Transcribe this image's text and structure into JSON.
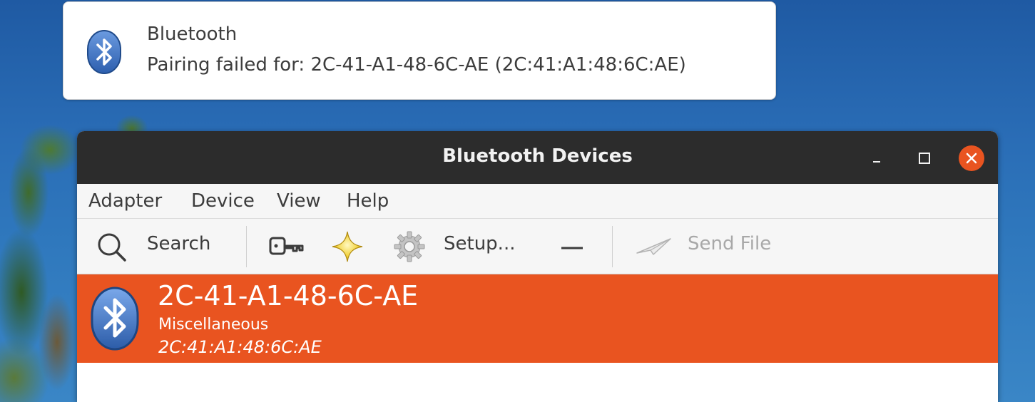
{
  "notification": {
    "title": "Bluetooth",
    "body": "Pairing failed for: 2C-41-A1-48-6C-AE (2C:41:A1:48:6C:AE)",
    "icon": "bluetooth-icon"
  },
  "window": {
    "title": "Bluetooth Devices",
    "controls": [
      "minimize",
      "maximize",
      "close"
    ],
    "close_color": "#e95420"
  },
  "menubar": {
    "items": [
      {
        "label": "Adapter"
      },
      {
        "label": "Device"
      },
      {
        "label": "View"
      },
      {
        "label": "Help"
      }
    ]
  },
  "toolbar": {
    "search_label": "Search",
    "search_icon": "magnifier-icon",
    "pair_icon": "key-icon",
    "trust_icon": "star-icon",
    "setup_label": "Setup...",
    "setup_icon": "gear-icon",
    "remove_icon": "minus-icon",
    "send_file_label": "Send File",
    "send_file_icon": "paper-plane-icon",
    "send_file_enabled": false
  },
  "devices": [
    {
      "name": "2C-41-A1-48-6C-AE",
      "type": "Miscellaneous",
      "address": "2C:41:A1:48:6C:AE",
      "selected": true,
      "icon": "bluetooth-icon"
    }
  ],
  "colors": {
    "accent": "#e95420",
    "titlebar": "#2c2c2c",
    "bluetooth_blue": "#3b72c4"
  }
}
